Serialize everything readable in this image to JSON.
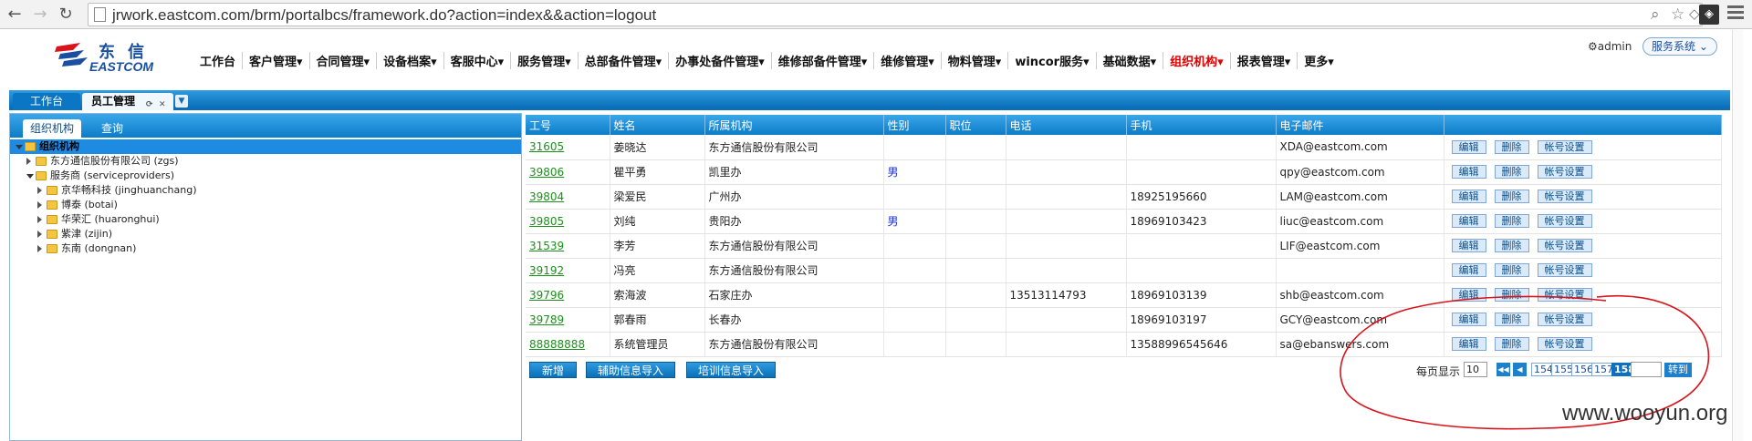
{
  "browser": {
    "url": "jrwork.eastcom.com/brm/portalbcs/framework.do?action=index&&action=logout",
    "back_icon": "back-arrow-icon",
    "forward_icon": "forward-arrow-icon",
    "reload_icon": "reload-icon"
  },
  "header": {
    "logo_cn": "东信",
    "logo_en": "EASTCOM",
    "nav": [
      {
        "label": "工作台",
        "active": false
      },
      {
        "label": "客户管理▾",
        "active": false
      },
      {
        "label": "合同管理▾",
        "active": false
      },
      {
        "label": "设备档案▾",
        "active": false
      },
      {
        "label": "客服中心▾",
        "active": false
      },
      {
        "label": "服务管理▾",
        "active": false
      },
      {
        "label": "总部备件管理▾",
        "active": false
      },
      {
        "label": "办事处备件管理▾",
        "active": false
      },
      {
        "label": "维修部备件管理▾",
        "active": false
      },
      {
        "label": "维修管理▾",
        "active": false
      },
      {
        "label": "物料管理▾",
        "active": false
      },
      {
        "label": "wincor服务▾",
        "active": false
      },
      {
        "label": "基础数据▾",
        "active": false
      },
      {
        "label": "组织机构▾",
        "active": true
      },
      {
        "label": "报表管理▾",
        "active": false
      },
      {
        "label": "更多▾",
        "active": false
      }
    ],
    "user": "admin",
    "system_button": "服务系统"
  },
  "tabs": {
    "home": "工作台",
    "current": "员工管理"
  },
  "left_panel": {
    "tab_active": "组织机构",
    "tab_inactive": "查询",
    "tree": [
      {
        "label": "组织机构",
        "level": 0,
        "open": true,
        "selected": true
      },
      {
        "label": "东方通信股份有限公司 (zgs)",
        "level": 1,
        "open": false,
        "selected": false
      },
      {
        "label": "服务商 (serviceproviders)",
        "level": 1,
        "open": true,
        "selected": false
      },
      {
        "label": "京华畅科技 (jinghuanchang)",
        "level": 2,
        "open": false,
        "selected": false
      },
      {
        "label": "博泰 (botai)",
        "level": 2,
        "open": false,
        "selected": false
      },
      {
        "label": "华荣汇 (huaronghui)",
        "level": 2,
        "open": false,
        "selected": false
      },
      {
        "label": "紫津 (zijin)",
        "level": 2,
        "open": false,
        "selected": false
      },
      {
        "label": "东南 (dongnan)",
        "level": 2,
        "open": false,
        "selected": false
      }
    ]
  },
  "table": {
    "columns": [
      "工号",
      "姓名",
      "所属机构",
      "性别",
      "职位",
      "电话",
      "手机",
      "电子邮件",
      ""
    ],
    "rows": [
      {
        "id": "31605",
        "name": "姜晓达",
        "org": "东方通信股份有限公司",
        "sex": "",
        "title": "",
        "phone": "",
        "mobile": "",
        "email": "XDA@eastcom.com"
      },
      {
        "id": "39806",
        "name": "瞿平勇",
        "org": "凯里办",
        "sex": "男",
        "title": "",
        "phone": "",
        "mobile": "",
        "email": "qpy@eastcom.com"
      },
      {
        "id": "39804",
        "name": "梁爱民",
        "org": "广州办",
        "sex": "",
        "title": "",
        "phone": "",
        "mobile": "18925195660",
        "email": "LAM@eastcom.com"
      },
      {
        "id": "39805",
        "name": "刘纯",
        "org": "贵阳办",
        "sex": "男",
        "title": "",
        "phone": "",
        "mobile": "18969103423",
        "email": "liuc@eastcom.com"
      },
      {
        "id": "31539",
        "name": "李芳",
        "org": "东方通信股份有限公司",
        "sex": "",
        "title": "",
        "phone": "",
        "mobile": "",
        "email": "LIF@eastcom.com"
      },
      {
        "id": "39192",
        "name": "冯亮",
        "org": "东方通信股份有限公司",
        "sex": "",
        "title": "",
        "phone": "",
        "mobile": "",
        "email": ""
      },
      {
        "id": "39796",
        "name": "索海波",
        "org": "石家庄办",
        "sex": "",
        "title": "",
        "phone": "13513114793",
        "mobile": "18969103139",
        "email": "shb@eastcom.com"
      },
      {
        "id": "39789",
        "name": "郭春雨",
        "org": "长春办",
        "sex": "",
        "title": "",
        "phone": "",
        "mobile": "18969103197",
        "email": "GCY@eastcom.com"
      },
      {
        "id": "88888888",
        "name": "系统管理员",
        "org": "东方通信股份有限公司",
        "sex": "",
        "title": "",
        "phone": "",
        "mobile": "13588996545646",
        "email": "sa@ebanswers.com"
      }
    ],
    "row_actions": {
      "edit": "编辑",
      "delete": "删除",
      "account": "帐号设置"
    }
  },
  "actions": {
    "add": "新增",
    "import_aux": "辅助信息导入",
    "import_train": "培训信息导入"
  },
  "pager": {
    "per_page_label": "每页显示",
    "per_page": "10",
    "pages": [
      "154",
      "155",
      "156",
      "157",
      "158"
    ],
    "current": "158",
    "go_label": "转到"
  },
  "watermark": "www.wooyun.org",
  "annotation_color": "#d8141c"
}
